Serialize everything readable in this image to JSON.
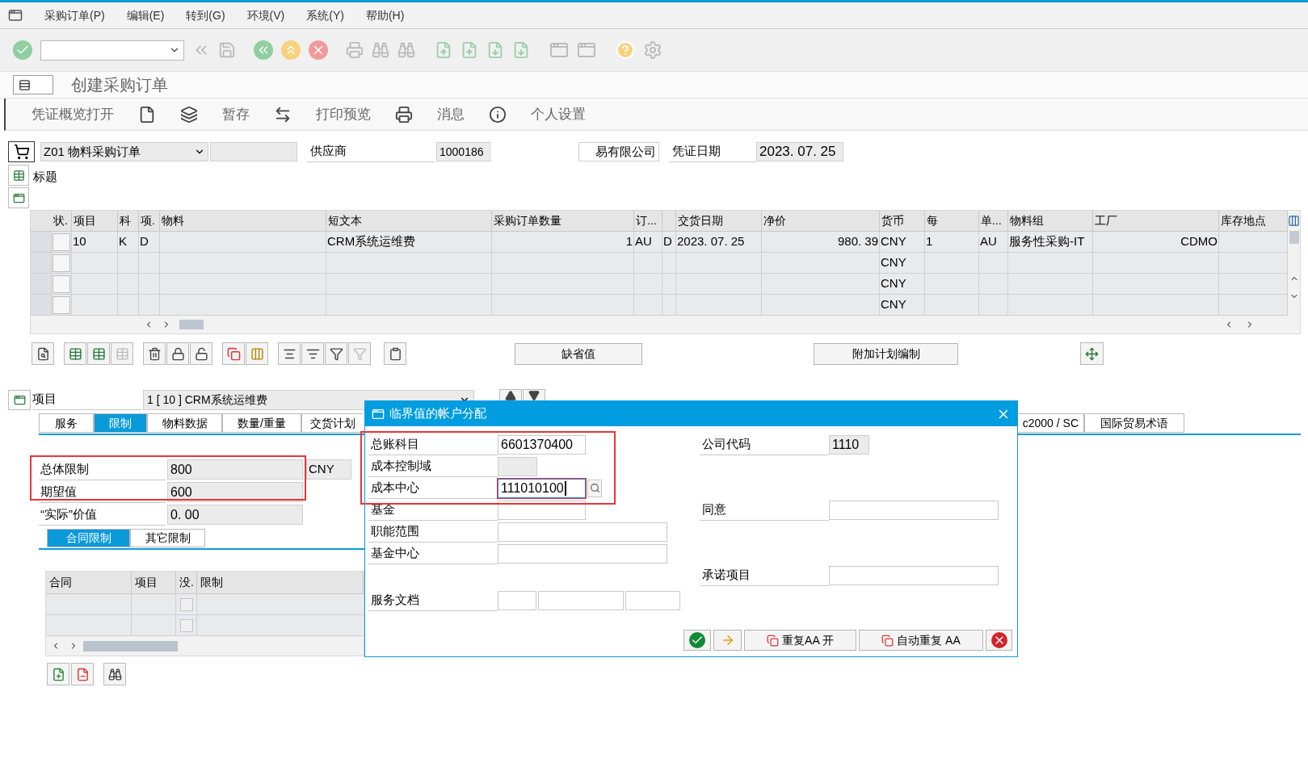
{
  "menu": [
    "采购订单(P)",
    "编辑(E)",
    "转到(G)",
    "环境(V)",
    "系统(Y)",
    "帮助(H)"
  ],
  "title": "创建采购订单",
  "app_toolbar": [
    "凭证概览打开",
    "暂存",
    "打印预览",
    "消息",
    "个人设置"
  ],
  "header": {
    "order_type": "Z01 物料采购订单",
    "vendor_label": "供应商",
    "vendor": "1000186",
    "vendor_name": "易有限公司",
    "date_label": "凭证日期",
    "date": "2023. 07. 25",
    "section_label": "标题"
  },
  "items_table": {
    "columns": [
      "状.",
      "项目",
      "科",
      "项.",
      "物料",
      "短文本",
      "采购订单数量",
      "订...",
      null,
      "交货日期",
      "净价",
      "货币",
      "每",
      "单...",
      "物料组",
      "工厂",
      "库存地点"
    ],
    "rows": [
      {
        "checked": false,
        "cells": [
          null,
          "10",
          "K",
          "D",
          null,
          "CRM系统运维费",
          "1",
          "AU",
          "D",
          "2023. 07. 25",
          "980. 39",
          "CNY",
          "1",
          "AU",
          "服务性采购-IT",
          "CDMO",
          null
        ]
      },
      {
        "checked": false,
        "cells": [
          null,
          null,
          null,
          null,
          null,
          null,
          null,
          null,
          null,
          null,
          null,
          "CNY",
          null,
          null,
          null,
          null,
          null
        ]
      },
      {
        "checked": false,
        "cells": [
          null,
          null,
          null,
          null,
          null,
          null,
          null,
          null,
          null,
          null,
          null,
          "CNY",
          null,
          null,
          null,
          null,
          null
        ]
      },
      {
        "checked": false,
        "cells": [
          null,
          null,
          null,
          null,
          null,
          null,
          null,
          null,
          null,
          null,
          null,
          "CNY",
          null,
          null,
          null,
          null,
          null
        ]
      }
    ]
  },
  "table_buttons": [
    "缺省值",
    "附加计划编制"
  ],
  "item_selector": {
    "label": "项目",
    "value": "1 [ 10 ] CRM系统运维费"
  },
  "tabs": [
    {
      "label": "服务",
      "selected": false
    },
    {
      "label": "限制",
      "selected": true
    },
    {
      "label": "物料数据",
      "selected": false
    },
    {
      "label": "数量/重量",
      "selected": false
    },
    {
      "label": "交货计划",
      "selected": false
    },
    {
      "label": "c2000 / SC",
      "selected": false
    },
    {
      "label": "国际贸易术语",
      "selected": false
    }
  ],
  "limits": {
    "highlighted": true,
    "fields": [
      {
        "label": "总体限制",
        "value": "800",
        "unit": "CNY"
      },
      {
        "label": "期望值",
        "value": "600"
      },
      {
        "label": "“实际”价值",
        "value": "0. 00"
      }
    ]
  },
  "sub_tabs": [
    {
      "label": "合同限制",
      "selected": true
    },
    {
      "label": "其它限制",
      "selected": false
    }
  ],
  "contract_table": {
    "columns": [
      "合同",
      "项目",
      "没.",
      "限制"
    ],
    "rows": [
      {
        "no_limit": false
      },
      {
        "no_limit": false
      }
    ]
  },
  "dialog": {
    "title": "临界值的帐户分配",
    "highlighted": true,
    "rows": [
      {
        "left": {
          "label": "总账科目",
          "value": "6601370400",
          "kind": "input",
          "focused": false
        },
        "right": {
          "label": "公司代码",
          "value": "1110",
          "kind": "display"
        }
      },
      {
        "left": {
          "label": "成本控制域",
          "kind": "display"
        }
      },
      {
        "left": {
          "label": "成本中心",
          "value": "111010100",
          "kind": "search",
          "focused": true
        }
      },
      {
        "left": {
          "label": "基金",
          "kind": "input",
          "focused": false
        },
        "right": {
          "label": "同意",
          "kind": "wide",
          "focused": false
        }
      },
      {
        "left": {
          "label": "职能范围",
          "kind": "wide",
          "focused": false
        }
      },
      {
        "left": {
          "label": "基金中心",
          "kind": "wide",
          "focused": false
        }
      },
      {
        "right": {
          "label": "承诺项目",
          "kind": "wide",
          "focused": false
        }
      },
      {
        "left": {
          "label": "服务文档",
          "kind": "triple"
        }
      }
    ],
    "buttons": [
      "重复AA 开",
      "自动重复 AA"
    ]
  }
}
